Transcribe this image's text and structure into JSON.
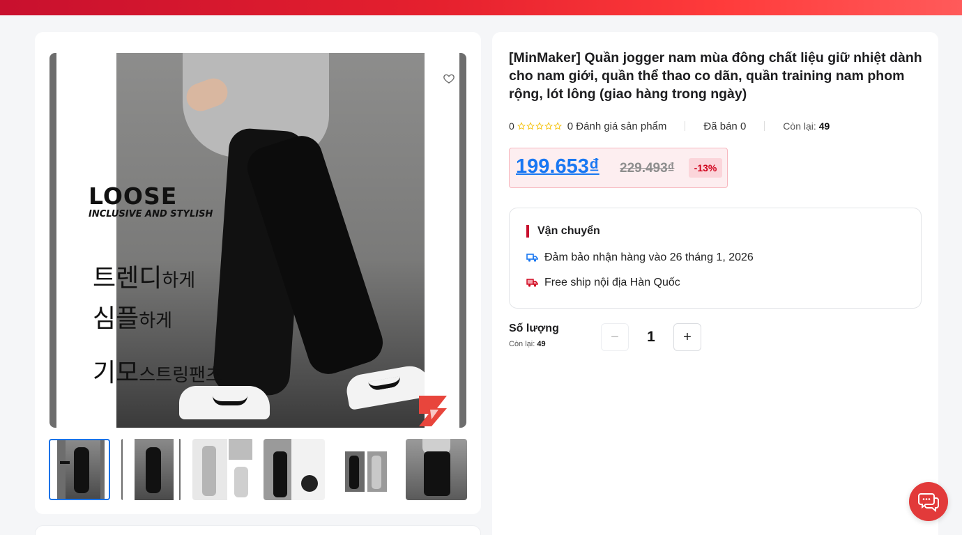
{
  "product": {
    "title": "[MinMaker] Quần jogger nam mùa đông chất liệu giữ nhiệt dành cho nam giới, quần thể thao co dãn, quần training nam phom rộng, lót lông (giao hàng trong ngày)",
    "rating_value": "0",
    "rating_stars": 0,
    "reviews_text": "0 Đánh giá sản phẩm",
    "sold_text": "Đã bán 0",
    "remaining_label": "Còn lại:",
    "remaining_value": "49"
  },
  "price": {
    "current": "199.653₫",
    "original": "229.493₫",
    "discount": "-13%"
  },
  "shipping": {
    "title": "Vận chuyển",
    "delivery_text": "Đảm bảo nhận hàng vào 26 tháng 1, 2026",
    "free_ship_text": "Free ship nội địa Hàn Quốc"
  },
  "quantity": {
    "label": "Số lượng",
    "remaining_label": "Còn lại:",
    "remaining_value": "49",
    "value": "1",
    "minus_symbol": "−",
    "plus_symbol": "+"
  },
  "main_image": {
    "headline": "LOOSE",
    "subheadline": "INCLUSIVE AND STYLISH",
    "line1_big": "트렌디",
    "line1_small": "하게",
    "line2_big": "심플",
    "line2_small": "하게",
    "line3_big": "기모",
    "line3_small": "스트링팬츠"
  },
  "thumbnails": [
    {
      "name": "thumb-1",
      "active": true
    },
    {
      "name": "thumb-2",
      "active": false
    },
    {
      "name": "thumb-3",
      "active": false
    },
    {
      "name": "thumb-4",
      "active": false
    },
    {
      "name": "thumb-5",
      "active": false
    },
    {
      "name": "thumb-6",
      "active": false
    }
  ],
  "colors": {
    "accent_red": "#c8102e",
    "price_blue": "#1877f2",
    "discount_red": "#d0021b",
    "star_yellow": "#f5c518",
    "thumb_active_border": "#1a73e8"
  },
  "icons": [
    "heart-icon",
    "star-icon",
    "truck-icon",
    "free-ship-truck-icon",
    "chat-icon"
  ]
}
